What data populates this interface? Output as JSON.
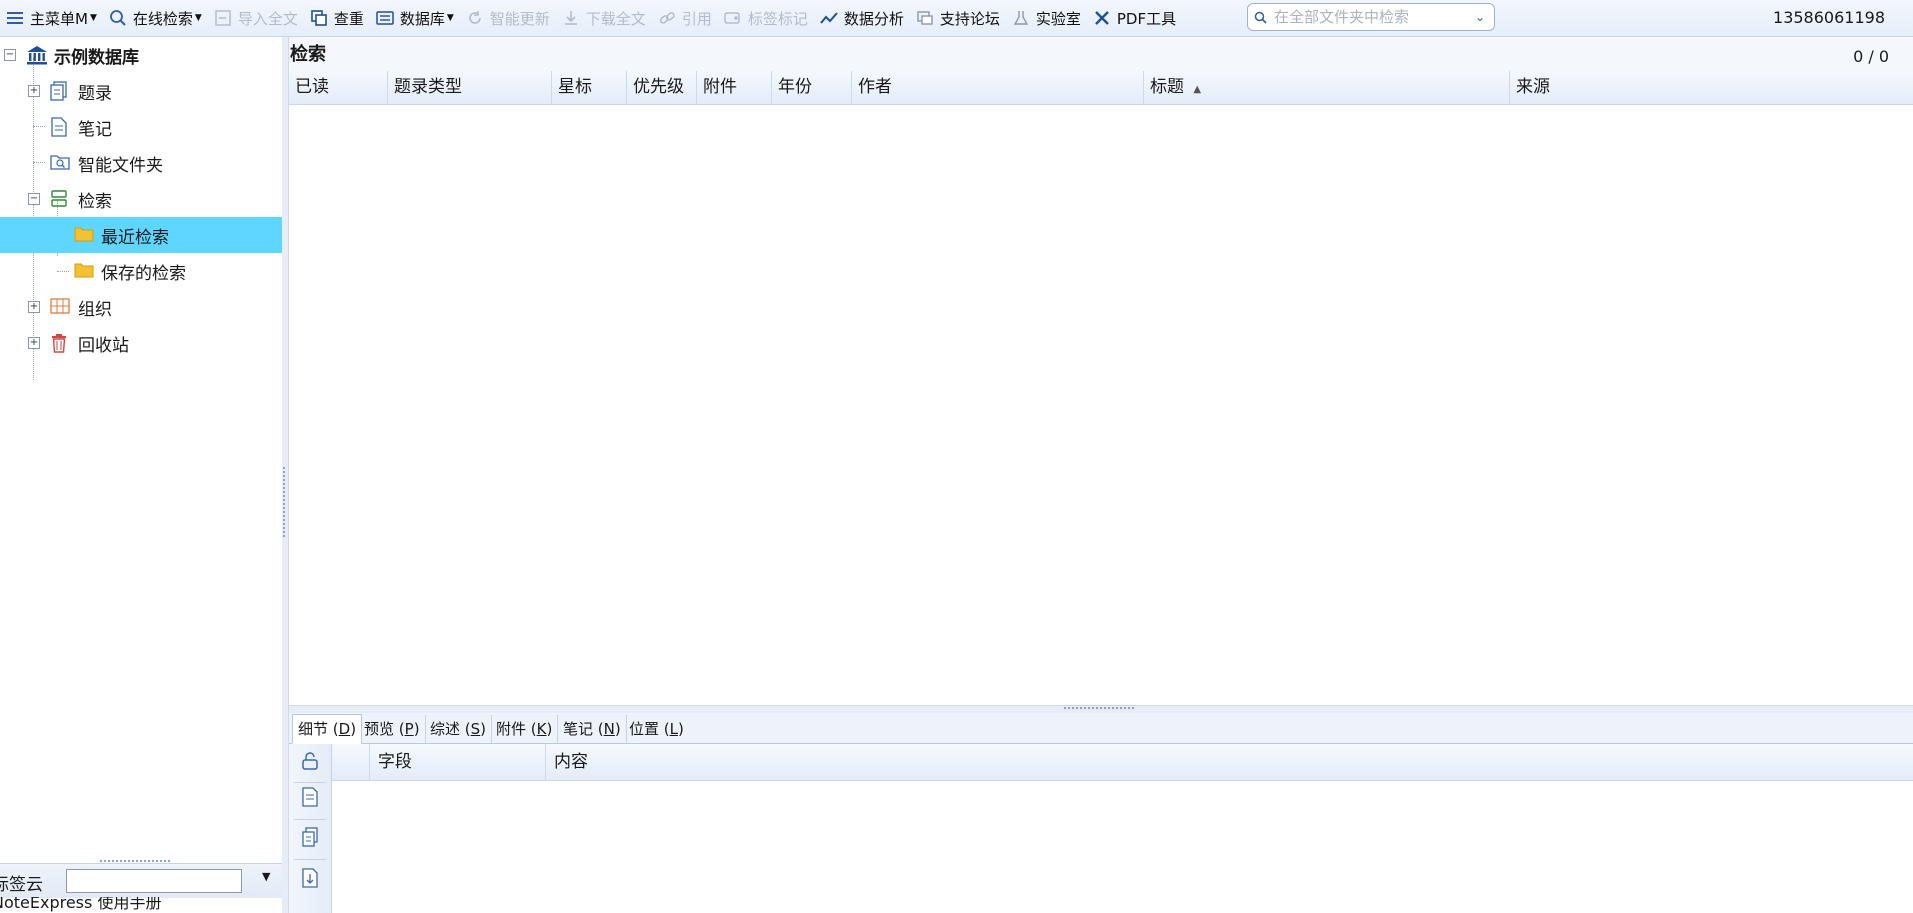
{
  "toolbar": {
    "main_menu": "主菜单M",
    "online_search": "在线检索",
    "import_fulltext": "导入全文",
    "dedupe": "查重",
    "database": "数据库",
    "smart_update": "智能更新",
    "download_fulltext": "下载全文",
    "cite": "引用",
    "tag_mark": "标签标记",
    "data_analysis": "数据分析",
    "support_forum": "支持论坛",
    "lab": "实验室",
    "pdf_tools": "PDF工具",
    "search_placeholder": "在全部文件夹中检索",
    "user_phone": "13586061198"
  },
  "tree": {
    "root": "示例数据库",
    "items": [
      {
        "label": "题录"
      },
      {
        "label": "笔记"
      },
      {
        "label": "智能文件夹"
      },
      {
        "label": "检索"
      },
      {
        "label": "最近检索"
      },
      {
        "label": "保存的检索"
      },
      {
        "label": "组织"
      },
      {
        "label": "回收站"
      }
    ]
  },
  "tagcloud": {
    "label": "标签云"
  },
  "manual": {
    "label": "NoteExpress 使用手册"
  },
  "results": {
    "title": "检索",
    "count": "0 / 0",
    "columns": [
      "已读",
      "题录类型",
      "星标",
      "优先级",
      "附件",
      "年份",
      "作者",
      "标题",
      "来源"
    ]
  },
  "detail": {
    "tabs": [
      {
        "name": "细节",
        "key": "D"
      },
      {
        "name": "预览",
        "key": "P"
      },
      {
        "name": "综述",
        "key": "S"
      },
      {
        "name": "附件",
        "key": "K"
      },
      {
        "name": "笔记",
        "key": "N"
      },
      {
        "name": "位置",
        "key": "L"
      }
    ],
    "columns": [
      "字段",
      "内容"
    ]
  },
  "colors": {
    "selection": "#5fd6ff",
    "accent": "#1f64c8"
  }
}
